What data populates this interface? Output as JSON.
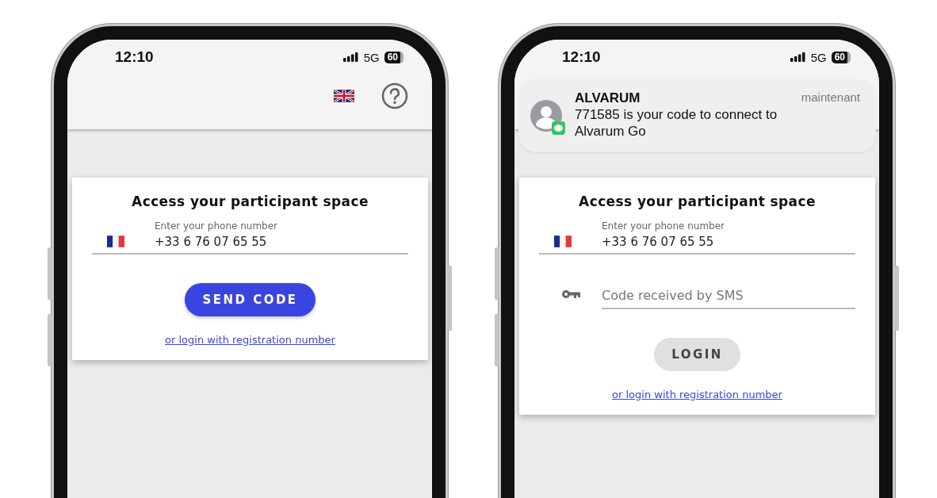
{
  "phones": [
    {
      "status_bar": {
        "time": "12:10",
        "network": "5G",
        "battery": "60"
      },
      "card": {
        "title": "Access your participant space",
        "phone_field": {
          "label": "Enter your phone number",
          "value": "+33 6 76 07 65 55"
        },
        "button": {
          "label": "SEND CODE",
          "kind": "primary"
        },
        "link": "or login with registration number"
      }
    },
    {
      "status_bar": {
        "time": "12:10",
        "network": "5G",
        "battery": "60"
      },
      "notification": {
        "sender": "ALVARUM",
        "time": "maintenant",
        "message": "771585 is your code to connect to Alvarum Go"
      },
      "card": {
        "title": "Access your participant space",
        "phone_field": {
          "label": "Enter your phone number",
          "value": "+33 6 76 07 65 55"
        },
        "code_field": {
          "placeholder": "Code received by SMS"
        },
        "button": {
          "label": "LOGIN",
          "kind": "secondary"
        },
        "link": "or login with registration number"
      }
    }
  ]
}
